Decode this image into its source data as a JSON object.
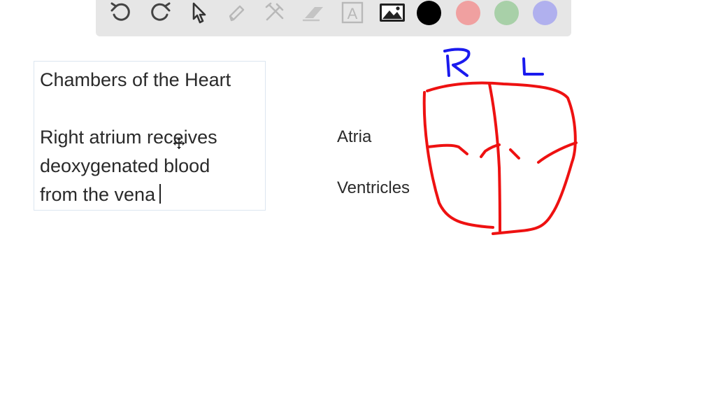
{
  "toolbar": {
    "tools": [
      {
        "name": "undo-icon"
      },
      {
        "name": "redo-icon"
      },
      {
        "name": "select-pointer-icon"
      },
      {
        "name": "pen-icon"
      },
      {
        "name": "shape-tools-icon"
      },
      {
        "name": "eraser-icon"
      },
      {
        "name": "text-tool-icon",
        "glyph": "A"
      },
      {
        "name": "image-icon"
      }
    ],
    "colors": [
      {
        "name": "black",
        "hex": "#000000"
      },
      {
        "name": "red",
        "hex": "#f0a0a0"
      },
      {
        "name": "green",
        "hex": "#a8d0a8"
      },
      {
        "name": "blue",
        "hex": "#b0b0ee"
      }
    ]
  },
  "note": {
    "lines": [
      "Chambers of the Heart",
      "",
      "Right atrium receives",
      "deoxygenated blood",
      "from the vena"
    ]
  },
  "diagram": {
    "labels": {
      "atria": "Atria",
      "ventricles": "Ventricles"
    },
    "handwriting": {
      "right": "R",
      "left": "L"
    },
    "ink_colors": {
      "heart": "#ee1111",
      "letters": "#1a1aee"
    }
  }
}
